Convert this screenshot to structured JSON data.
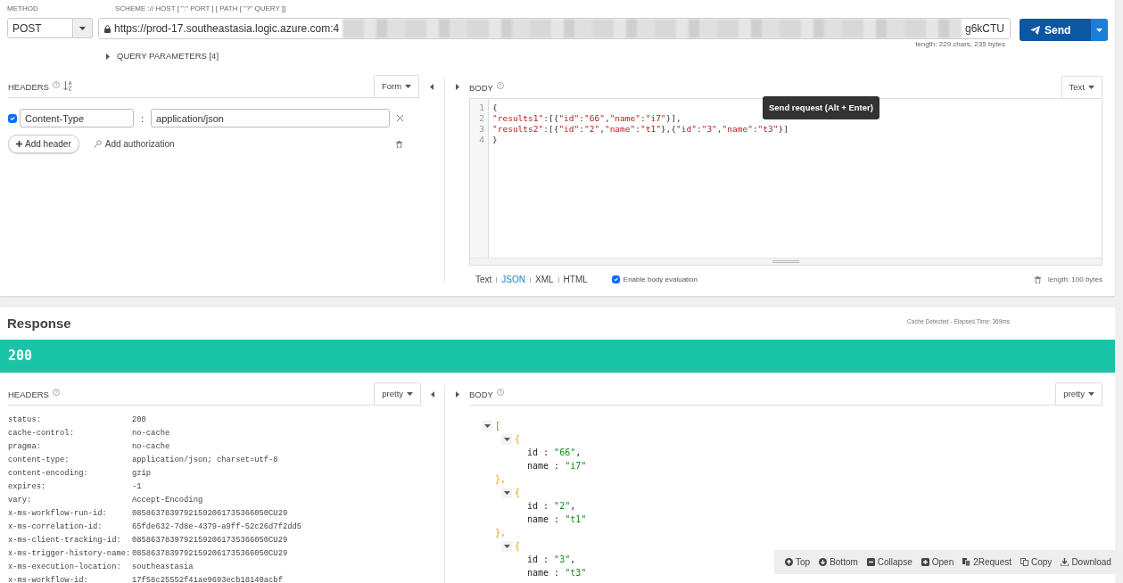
{
  "request": {
    "method_label": "METHOD",
    "method": "POST",
    "url_label": "SCHEME :// HOST [ \":\" PORT ] [ PATH [ \"?\" QUERY ]]",
    "url_start": "https://prod-17.southeastasia.logic.azure.com:4",
    "url_end": "g6kCTU",
    "send": "Send",
    "length": "length: 229 chars, 235 bytes",
    "query_params": {
      "label": "QUERY PARAMETERS [4]",
      "expanded": false
    }
  },
  "tooltip": "Send request (Alt + Enter)",
  "request_headers": {
    "title": "HEADERS",
    "mode": "Form",
    "add_header": "Add header",
    "add_authorization": "Add authorization",
    "rows": [
      {
        "checked": true,
        "name": "Content-Type",
        "separator": ":",
        "value": "application/json"
      }
    ]
  },
  "request_body": {
    "title": "BODY",
    "mode": "Text",
    "length": "length: 100 bytes",
    "lines": [
      {
        "number": "1",
        "text": "{"
      },
      {
        "number": "2",
        "text": "\"results1\":[{\"id\":\"66\",\"name\":\"i7\"}],"
      },
      {
        "number": "3",
        "text": "\"results2\":[{\"id\":\"2\",\"name\":\"t1\"},{\"id\":\"3\",\"name\":\"t3\"}]"
      },
      {
        "number": "4",
        "text": "}"
      }
    ],
    "formats": [
      {
        "label": "Text",
        "selected": false
      },
      {
        "label": "JSON",
        "selected": true
      },
      {
        "label": "XML",
        "selected": false
      },
      {
        "label": "HTML",
        "selected": false
      }
    ],
    "evaluation": {
      "label": "Enable body evaluation",
      "checked": true
    }
  },
  "response": {
    "title": "Response",
    "cache_info": "Cache Detected - Elapsed Time: 369ms",
    "status": "200",
    "headers": {
      "title": "HEADERS",
      "mode": "pretty",
      "rows": [
        {
          "name": "status:",
          "value": "200"
        },
        {
          "name": "cache-control:",
          "value": "no-cache"
        },
        {
          "name": "pragma:",
          "value": "no-cache"
        },
        {
          "name": "content-type:",
          "value": "application/json; charset=utf-8"
        },
        {
          "name": "content-encoding:",
          "value": "gzip"
        },
        {
          "name": "expires:",
          "value": "-1"
        },
        {
          "name": "vary:",
          "value": "Accept-Encoding"
        },
        {
          "name": "x-ms-workflow-run-id:",
          "value": "08586378397921592061735366050CU29"
        },
        {
          "name": "x-ms-correlation-id:",
          "value": "65fde632-7d8e-4379-a9ff-52c26d7f2dd5"
        },
        {
          "name": "x-ms-client-tracking-id:",
          "value": "08586378397921592061735366050CU29"
        },
        {
          "name": "x-ms-trigger-history-name:",
          "value": "08586378397921592061735366050CU29"
        },
        {
          "name": "x-ms-execution-location:",
          "value": "southeastasia"
        },
        {
          "name": "x-ms-workflow-id:",
          "value": "17f58c25552f41ae9693ecb18140acbf"
        }
      ]
    },
    "body": {
      "title": "BODY",
      "mode": "pretty",
      "tree": {
        "text": "[",
        "expanded": true,
        "children": [
          {
            "text": "{",
            "expanded": true,
            "close": "},",
            "children": [
              {
                "text": "id : \"66\","
              },
              {
                "text": "name : \"i7\""
              }
            ]
          },
          {
            "text": "{",
            "expanded": true,
            "close": "},",
            "children": [
              {
                "text": "id : \"2\","
              },
              {
                "text": "name : \"t1\""
              }
            ]
          },
          {
            "text": "{",
            "expanded": true,
            "children": [
              {
                "text": "id : \"3\","
              },
              {
                "text": "name : \"t3\""
              }
            ]
          }
        ]
      }
    }
  },
  "toolbar": [
    {
      "kind": "up",
      "label": "Top"
    },
    {
      "kind": "down",
      "label": "Bottom"
    },
    {
      "kind": "collapse",
      "label": "Collapse"
    },
    {
      "kind": "open",
      "label": "Open"
    },
    {
      "kind": "request",
      "label": "2Request"
    },
    {
      "kind": "copy",
      "label": "Copy"
    },
    {
      "kind": "download",
      "label": "Download"
    }
  ]
}
